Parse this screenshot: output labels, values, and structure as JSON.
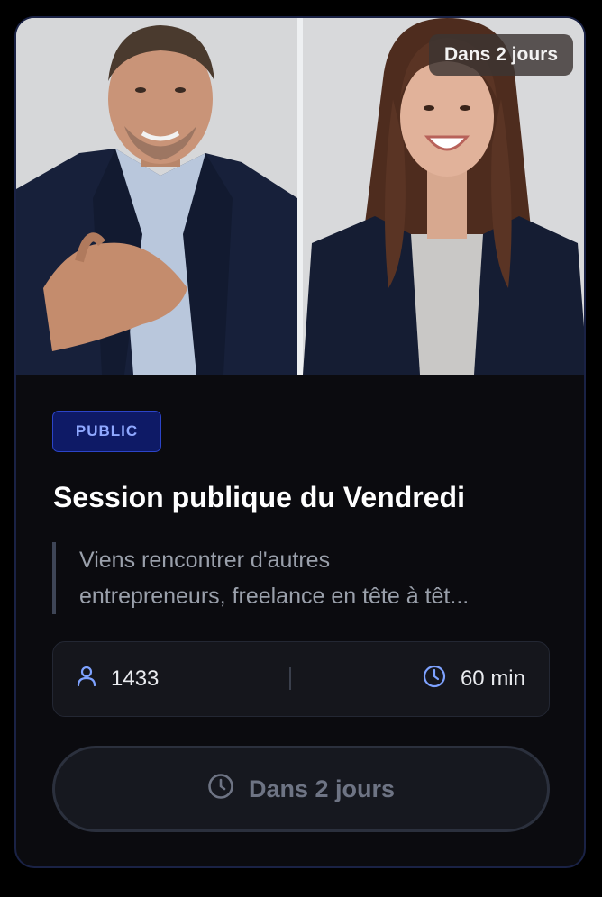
{
  "event": {
    "countdown_badge": "Dans 2 jours",
    "visibility_tag": "PUBLIC",
    "title": "Session publique du Vendredi",
    "description_line1": "Viens rencontrer d'autres",
    "description_line2": "entrepreneurs, freelance en tête à têt...",
    "participants": "1433",
    "duration": "60 min",
    "action_label": "Dans 2 jours"
  },
  "icons": {
    "participants": "user-icon",
    "duration": "clock-icon",
    "action": "clock-icon"
  },
  "colors": {
    "card_background": "#0b0b0f",
    "accent_blue": "#8fa8ff",
    "tag_background": "#0e1a66",
    "muted_text": "#9aa0ab"
  }
}
